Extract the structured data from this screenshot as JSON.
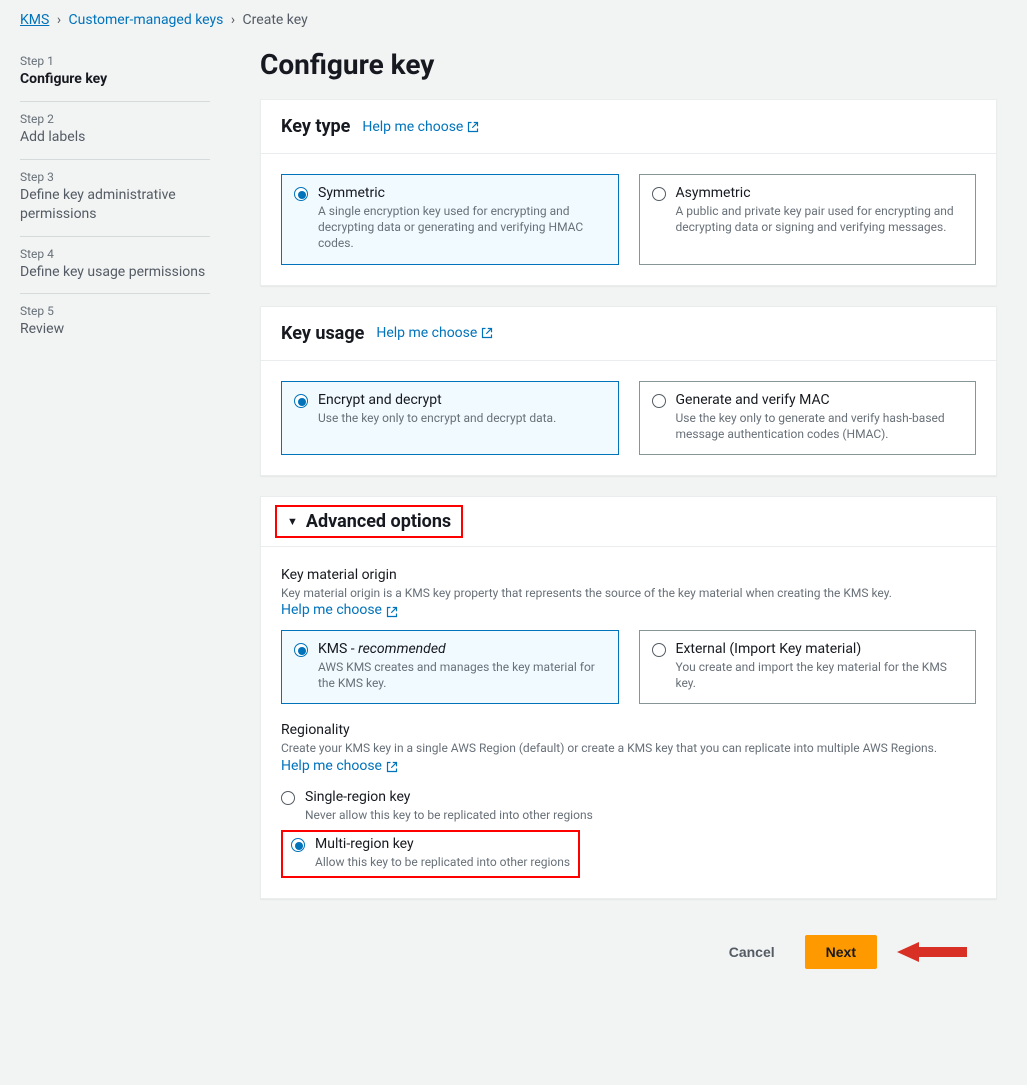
{
  "breadcrumb": {
    "kms": "KMS",
    "customer_keys": "Customer-managed keys",
    "create_key": "Create key"
  },
  "sidebar": {
    "steps": [
      {
        "label": "Step 1",
        "title": "Configure key",
        "active": true
      },
      {
        "label": "Step 2",
        "title": "Add labels",
        "active": false
      },
      {
        "label": "Step 3",
        "title": "Define key administrative permissions",
        "active": false
      },
      {
        "label": "Step 4",
        "title": "Define key usage permissions",
        "active": false
      },
      {
        "label": "Step 5",
        "title": "Review",
        "active": false
      }
    ]
  },
  "page": {
    "title": "Configure key"
  },
  "key_type": {
    "heading": "Key type",
    "help": "Help me choose",
    "symmetric": {
      "title": "Symmetric",
      "desc": "A single encryption key used for encrypting and decrypting data or generating and verifying HMAC codes.",
      "selected": true
    },
    "asymmetric": {
      "title": "Asymmetric",
      "desc": "A public and private key pair used for encrypting and decrypting data or signing and verifying messages.",
      "selected": false
    }
  },
  "key_usage": {
    "heading": "Key usage",
    "help": "Help me choose",
    "encrypt": {
      "title": "Encrypt and decrypt",
      "desc": "Use the key only to encrypt and decrypt data.",
      "selected": true
    },
    "mac": {
      "title": "Generate and verify MAC",
      "desc": "Use the key only to generate and verify hash-based message authentication codes (HMAC).",
      "selected": false
    }
  },
  "advanced": {
    "heading": "Advanced options",
    "material_origin": {
      "title": "Key material origin",
      "desc_prefix": "Key material origin is a KMS key property that represents the source of the key material when creating the KMS key. ",
      "help": "Help me choose",
      "kms": {
        "title_main": "KMS - ",
        "title_italic": "recommended",
        "desc": "AWS KMS creates and manages the key material for the KMS key.",
        "selected": true
      },
      "external": {
        "title": "External (Import Key material)",
        "desc": "You create and import the key material for the KMS key.",
        "selected": false
      }
    },
    "regionality": {
      "title": "Regionality",
      "desc_prefix": "Create your KMS key in a single AWS Region (default) or create a KMS key that you can replicate into multiple AWS Regions. ",
      "help": "Help me choose",
      "single": {
        "title": "Single-region key",
        "desc": "Never allow this key to be replicated into other regions",
        "selected": false
      },
      "multi": {
        "title": "Multi-region key",
        "desc": "Allow this key to be replicated into other regions",
        "selected": true
      }
    }
  },
  "footer": {
    "cancel": "Cancel",
    "next": "Next"
  }
}
